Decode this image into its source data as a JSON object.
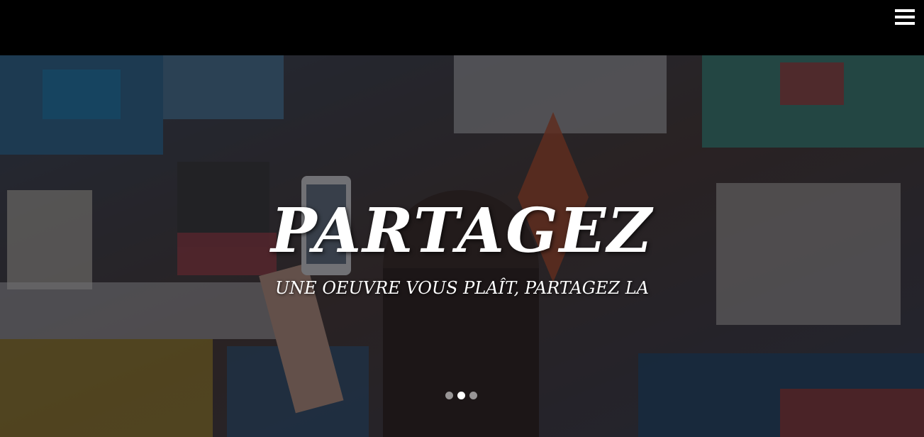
{
  "header": {
    "menu_icon": "hamburger-menu-icon"
  },
  "slide": {
    "title": "PARTAGEZ",
    "subtitle": "UNE OEUVRE VOUS PLAÎT, PARTAGEZ LA"
  },
  "carousel": {
    "slide_count": 3,
    "active_index": 1
  },
  "colors": {
    "topbar": "#000000",
    "text": "#ffffff"
  }
}
